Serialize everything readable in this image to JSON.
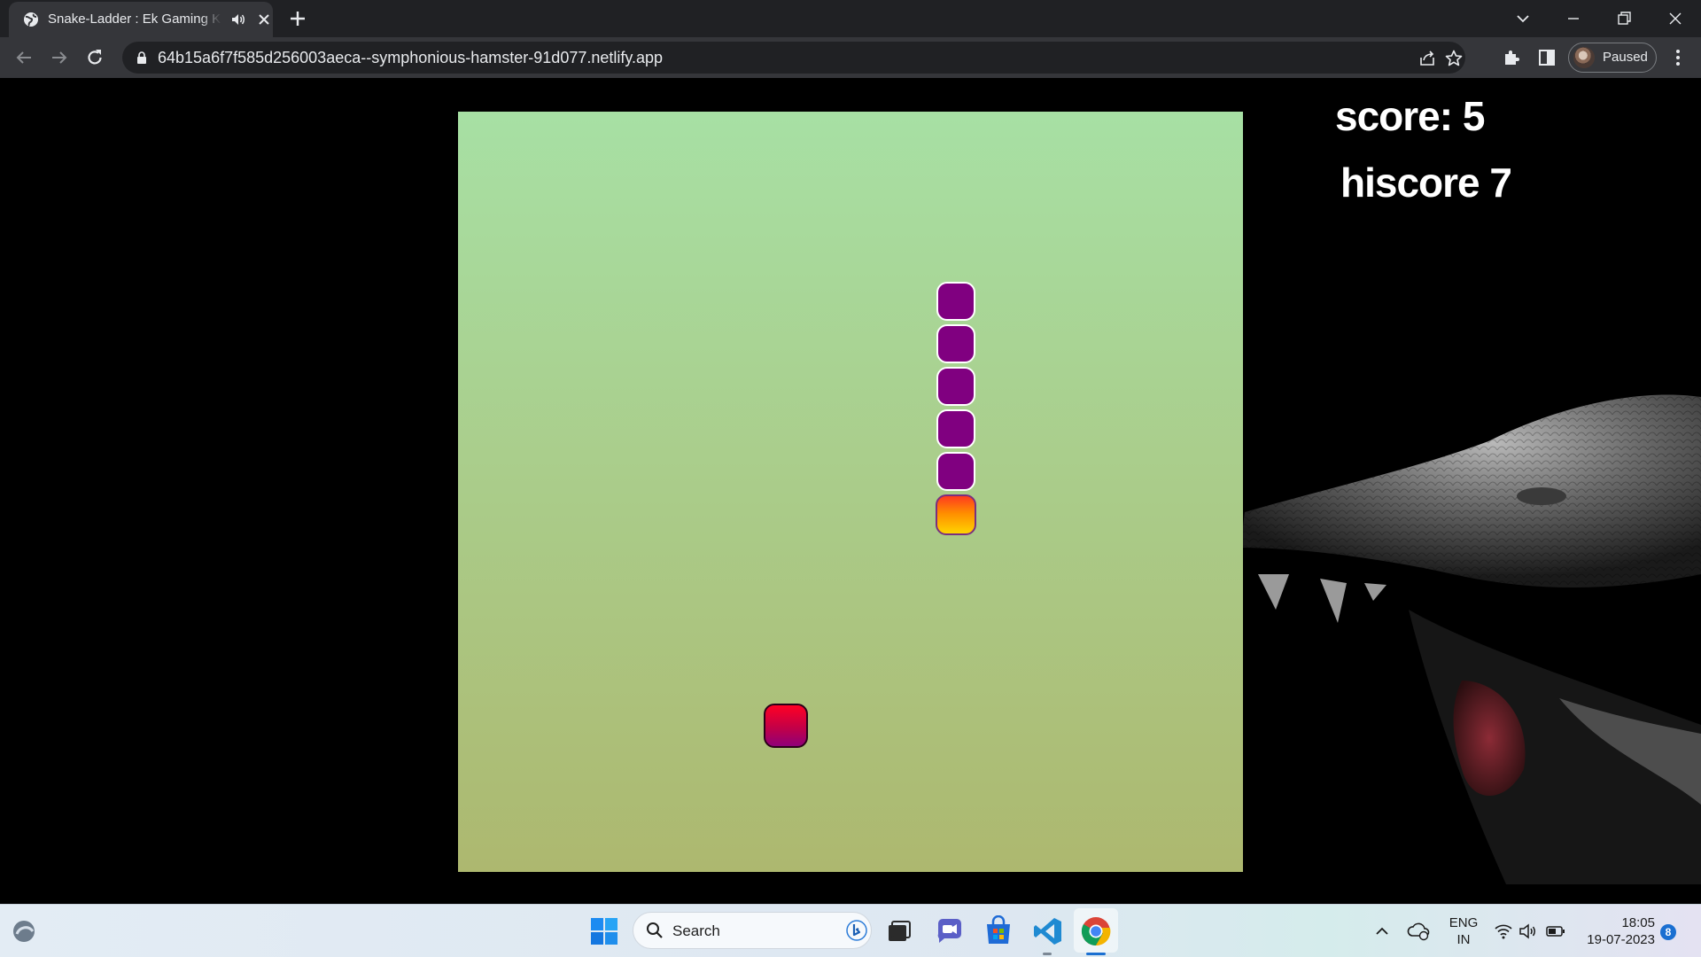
{
  "browser": {
    "tab": {
      "title": "Snake-Ladder : Ek Gaming Ka",
      "favicon": "globe-icon",
      "audio": "speaker-icon"
    },
    "url": "64b15a6f7f585d256003aeca--symphonious-hamster-91d077.netlify.app",
    "profile_label": "Paused"
  },
  "game": {
    "score_text": "score: 5",
    "hiscore_text": "hiscore 7",
    "snake_color": "#800080",
    "head_gradient": [
      "#ff3b1f",
      "#ff8c00",
      "#ffd400"
    ],
    "food_gradient": [
      "#ff0024",
      "#c30047",
      "#8f0079"
    ],
    "board_gradient": [
      "#a7e0a4",
      "#adb86f"
    ]
  },
  "taskbar": {
    "search_label": "Search",
    "language": {
      "line1": "ENG",
      "line2": "IN"
    },
    "clock": {
      "time": "18:05",
      "date": "19-07-2023"
    },
    "notification_count": "8"
  }
}
